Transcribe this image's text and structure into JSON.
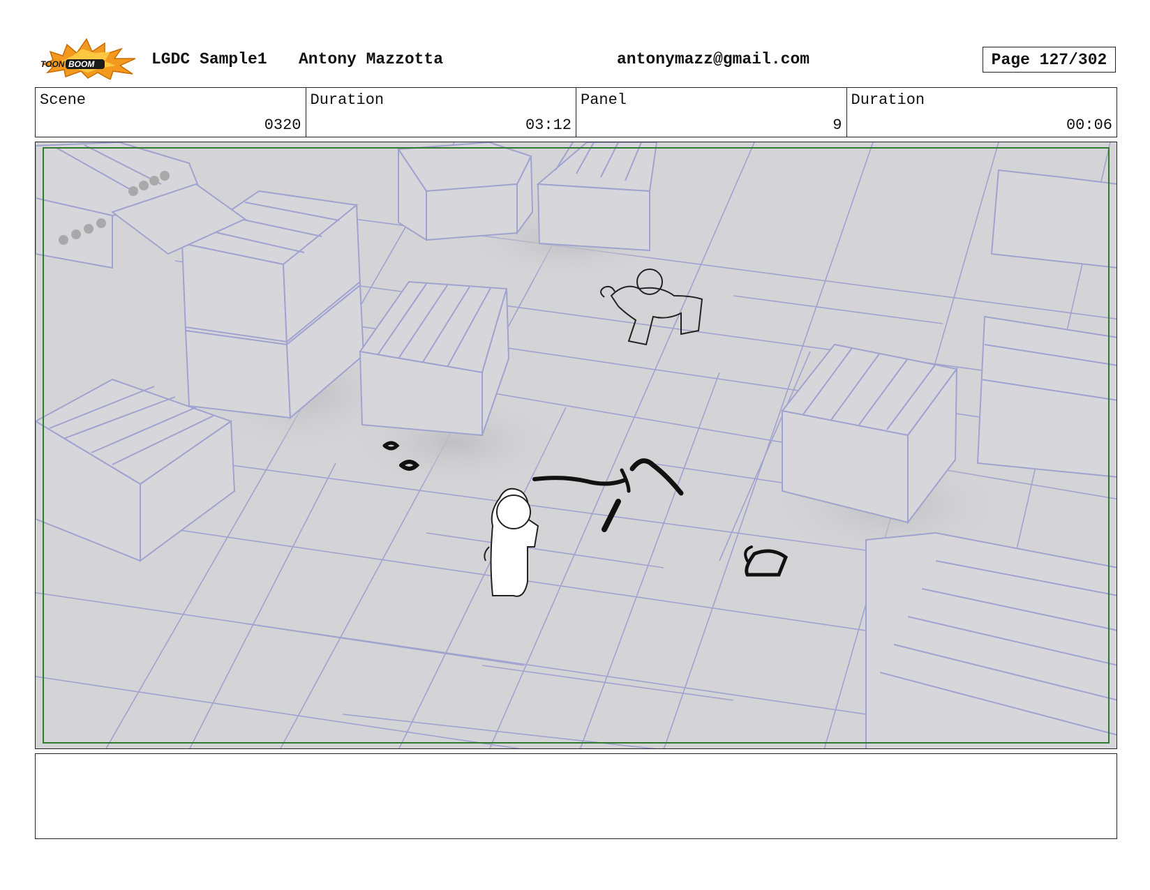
{
  "header": {
    "logo_text": "TOON BOOM",
    "project": "LGDC Sample1",
    "author": "Antony Mazzotta",
    "email": "antonymazz@gmail.com",
    "page": "Page 127/302"
  },
  "info": {
    "scene_label": "Scene",
    "scene_value": "0320",
    "scene_duration_label": "Duration",
    "scene_duration_value": "03:12",
    "panel_label": "Panel",
    "panel_value": "9",
    "panel_duration_label": "Duration",
    "panel_duration_value": "00:06"
  },
  "colors": {
    "logo_orange": "#f39a1e",
    "grid_line": "#9ea0cc",
    "floor": "#d4d4d6",
    "safe_frame": "#2f7a2f"
  },
  "notes": ""
}
